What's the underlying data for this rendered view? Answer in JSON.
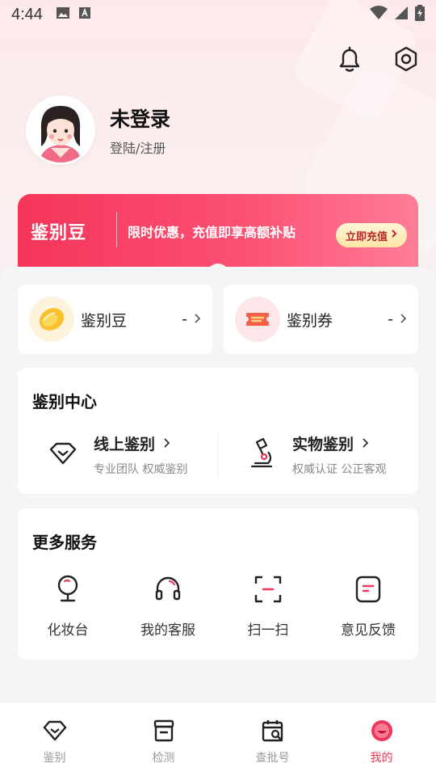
{
  "status_bar": {
    "time": "4:44"
  },
  "profile": {
    "name": "未登录",
    "subtitle": "登陆/注册"
  },
  "banner": {
    "logo": "鉴别豆",
    "promo_text": "限时优惠，充值即享高额补贴",
    "button_label": "立即充值"
  },
  "wallet": [
    {
      "label": "鉴别豆",
      "value": "-"
    },
    {
      "label": "鉴别券",
      "value": "-"
    }
  ],
  "center": {
    "title": "鉴别中心",
    "items": [
      {
        "title": "线上鉴别",
        "subtitle": "专业团队 权威鉴别"
      },
      {
        "title": "实物鉴别",
        "subtitle": "权威认证 公正客观"
      }
    ]
  },
  "services": {
    "title": "更多服务",
    "items": [
      {
        "label": "化妆台",
        "icon": "mirror-icon"
      },
      {
        "label": "我的客服",
        "icon": "headset-icon"
      },
      {
        "label": "扫一扫",
        "icon": "scan-icon"
      },
      {
        "label": "意见反馈",
        "icon": "feedback-icon"
      }
    ]
  },
  "nav": [
    {
      "label": "鉴别",
      "icon": "diamond-icon"
    },
    {
      "label": "检测",
      "icon": "box-icon"
    },
    {
      "label": "查批号",
      "icon": "calendar-search-icon"
    },
    {
      "label": "我的",
      "icon": "profile-icon",
      "active": true
    }
  ],
  "colors": {
    "accent": "#f0365a",
    "banner_start": "#f5355a",
    "banner_end": "#ff7d97"
  }
}
